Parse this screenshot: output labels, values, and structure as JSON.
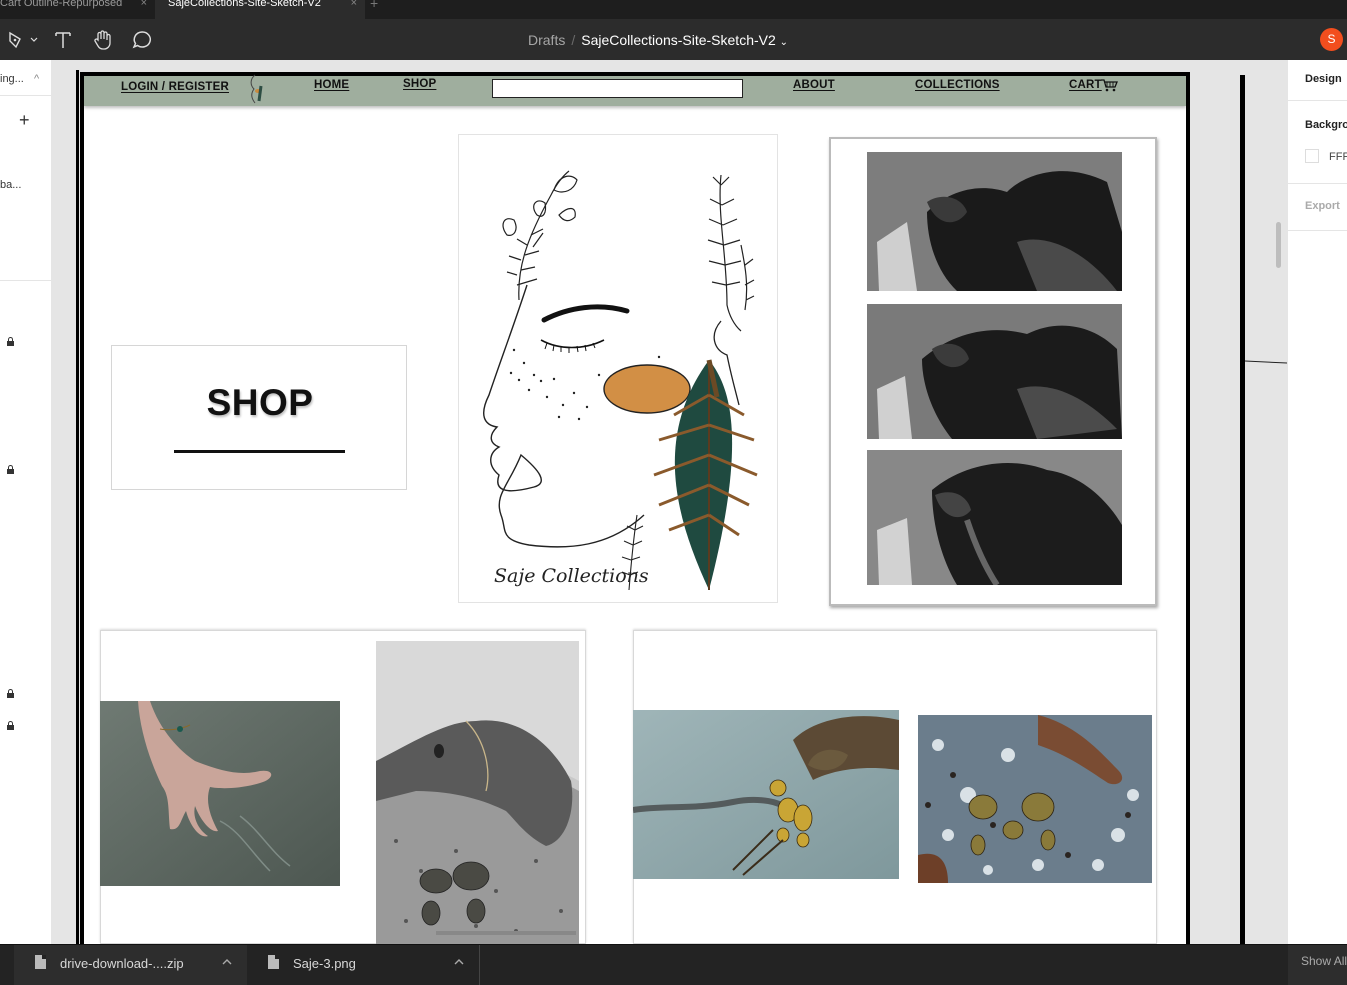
{
  "tabs": [
    {
      "label": "Cart Outline-Repurposed",
      "close": "×"
    },
    {
      "label": "SajeCollections-Site-Sketch-V2",
      "close": "×"
    }
  ],
  "tab_add": "+",
  "breadcrumb": {
    "drafts": "Drafts",
    "sep": "/",
    "file": "SajeCollections-Site-Sketch-V2",
    "caret": "⌄"
  },
  "user": {
    "initial": "S",
    "color": "#f24e1e"
  },
  "left_panel": {
    "page_name": "ing...",
    "page_caret": "^",
    "add": "+",
    "layer_name": "ba..."
  },
  "site": {
    "nav": {
      "login": "LOGIN / REGISTER",
      "home": "HOME",
      "shop": "SHOP",
      "about": "ABOUT",
      "collections": "COLLECTIONS",
      "cart": "CART"
    },
    "nav_color": "#9fae9e",
    "shop_heading": "SHOP",
    "logo_text": "Saje Collections"
  },
  "right_panel": {
    "tab": "Design",
    "background_label": "Backgro",
    "background_value": "FFF",
    "export_label": "Export"
  },
  "downloads": [
    {
      "name": "drive-download-....zip",
      "caret": "^"
    },
    {
      "name": "Saje-3.png",
      "caret": "^"
    }
  ],
  "show_all": "Show All"
}
